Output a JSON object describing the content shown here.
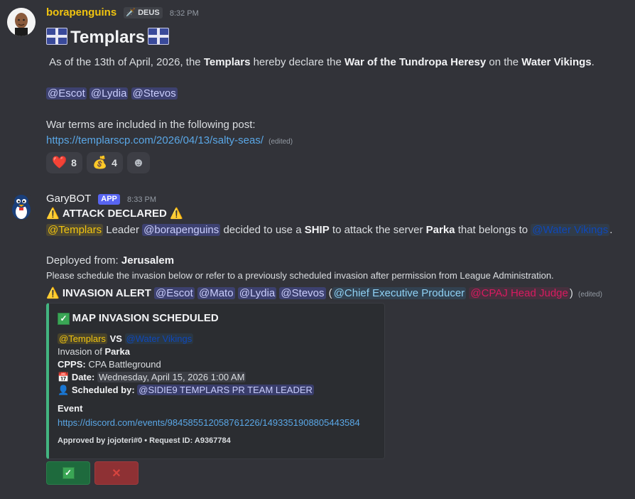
{
  "message1": {
    "username": "borapenguins",
    "role_badge": "DEUS",
    "timestamp": "8:32 PM",
    "title": "Templars",
    "declaration": {
      "prefix": "As of the 13th of April, 2026, the",
      "team": "Templars",
      "mid": "hereby declare the",
      "war_name": "War of the Tundropa Heresy",
      "on": "on the",
      "enemy": "Water Vikings",
      "end": "."
    },
    "mentions": [
      "@Escot",
      "@Lydia",
      "@Stevos"
    ],
    "terms_text": "War terms are included in the following post:",
    "link": "https://templarscp.com/2026/04/13/salty-seas/",
    "edited": "(edited)",
    "reactions": [
      {
        "icon": "heart-icon",
        "glyph": "❤️",
        "count": "8"
      },
      {
        "icon": "money-bag-icon",
        "glyph": "💰",
        "count": "4"
      }
    ],
    "add_reaction_icon": "smiley-icon"
  },
  "message2": {
    "username": "GaryBOT",
    "app_badge": "APP",
    "timestamp": "8:33 PM",
    "attack_header": "ATTACK DECLARED",
    "attack_line": {
      "mention_team": "@Templars",
      "leader_word": "Leader",
      "mention_leader": "@borapenguins",
      "decided": "decided to use a",
      "unit": "SHIP",
      "to_attack": "to attack the server",
      "server": "Parka",
      "belongs": "that belongs to",
      "mention_enemy": "@Water Vikings",
      "end": "."
    },
    "deployed_label": "Deployed from:",
    "deployed_value": "Jerusalem",
    "schedule_note": "Please schedule the invasion below or refer to a previously scheduled invasion after permission from League Administration.",
    "alert_label": "INVASION ALERT",
    "alert_mentions": [
      "@Escot",
      "@Mato",
      "@Lydia",
      "@Stevos"
    ],
    "alert_role_1": "@Chief Executive Producer",
    "alert_role_2": "@CPAJ Head Judge",
    "edited": "(edited)",
    "embed": {
      "title": "MAP INVASION SCHEDULED",
      "attacker": "@Templars",
      "vs": "VS",
      "defender": "@Water Vikings",
      "invasion_of_label": "Invasion of",
      "invasion_of_value": "Parka",
      "cpps_label": "CPPS:",
      "cpps_value": "CPA Battleground",
      "date_label": "Date:",
      "date_value": "Wednesday, April 15, 2026 1:00 AM",
      "scheduled_label": "Scheduled by:",
      "scheduled_value": "@SIDIE9 TEMPLARS PR TEAM LEADER",
      "event_label": "Event",
      "event_link": "https://discord.com/events/984585512058761226/1493351908805443584",
      "footer": "Approved by jojoteri#0 • Request ID: A9367784"
    }
  },
  "colors": {
    "background": "#323339",
    "embed_border": "#43b581",
    "mention_bg": "#4a4f8a",
    "link": "#5aa7e6",
    "approve_button": "#1e6a3d",
    "deny_button": "#8e3134"
  }
}
